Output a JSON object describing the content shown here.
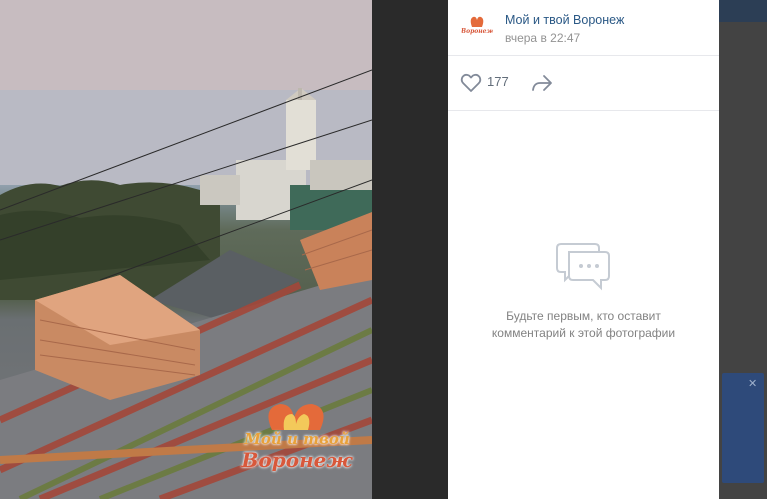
{
  "post": {
    "group_name": "Мой и твой Воронеж",
    "time": "вчера в 22:47",
    "likes": "177"
  },
  "comments": {
    "empty_line1": "Будьте первым, кто оставит",
    "empty_line2": "комментарий к этой фотографии"
  },
  "watermark": {
    "line1": "Мой и твой",
    "line2": "Воронеж"
  },
  "avatar": {
    "text": "Мой и твой Воронеж"
  },
  "icons": {
    "like": "heart-outline-icon",
    "share": "share-arrow-icon",
    "empty_comments": "chat-bubble-icon"
  },
  "colors": {
    "link": "#2a5885",
    "muted": "#939393",
    "brand_orange": "#e8a13a",
    "brand_red": "#d8583b"
  }
}
